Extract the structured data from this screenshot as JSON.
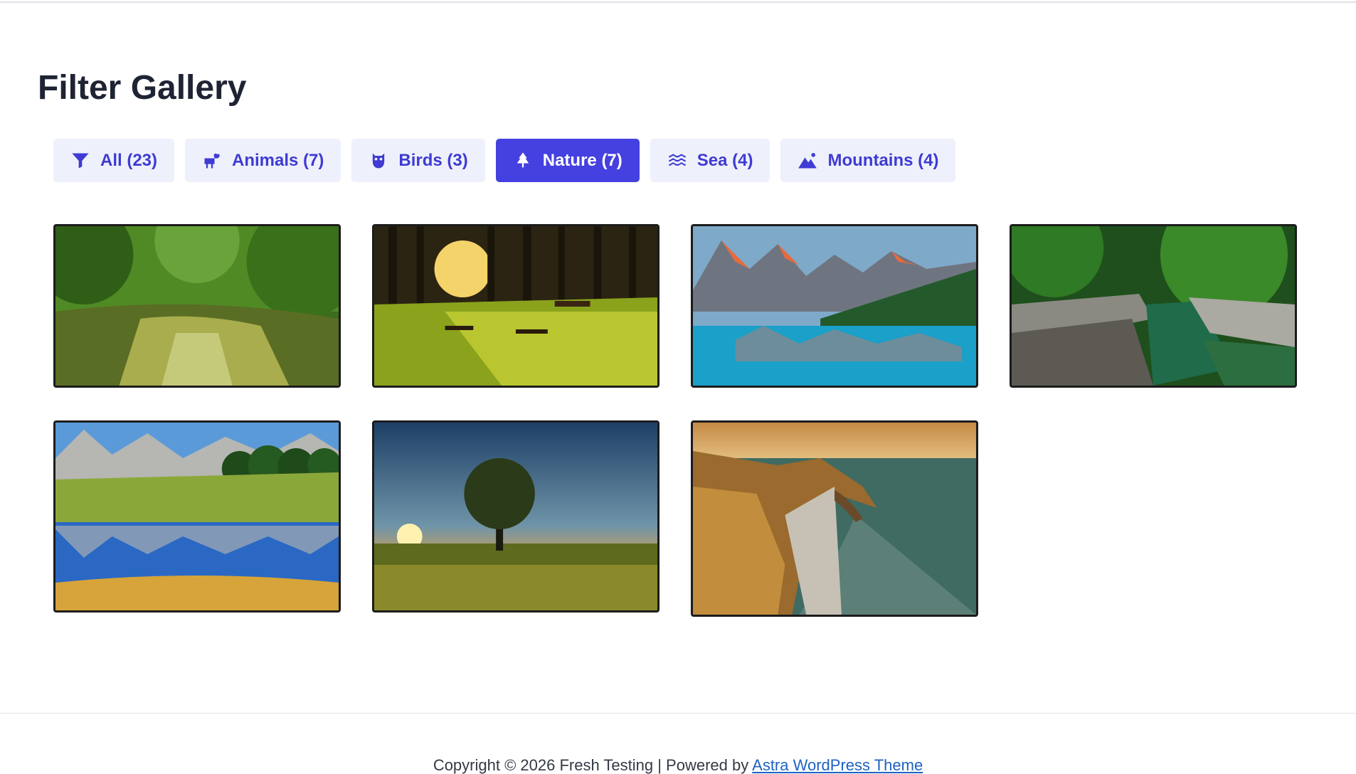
{
  "page": {
    "title": "Filter Gallery"
  },
  "filters": [
    {
      "label": "All (23)",
      "icon": "filter-icon",
      "active": false
    },
    {
      "label": "Animals (7)",
      "icon": "dog-icon",
      "active": false
    },
    {
      "label": "Birds (3)",
      "icon": "owl-icon",
      "active": false
    },
    {
      "label": "Nature (7)",
      "icon": "tree-icon",
      "active": true
    },
    {
      "label": "Sea (4)",
      "icon": "water-icon",
      "active": false
    },
    {
      "label": "Mountains (4)",
      "icon": "mountain-icon",
      "active": false
    }
  ],
  "gallery": {
    "items": [
      {
        "icon": "forest-river-image"
      },
      {
        "icon": "sunlit-forest-image"
      },
      {
        "icon": "mountain-lake-image"
      },
      {
        "icon": "forest-creek-image"
      },
      {
        "icon": "alpine-lake-image"
      },
      {
        "icon": "lone-tree-sunset-image"
      },
      {
        "icon": "coastal-arch-image"
      }
    ]
  },
  "footer": {
    "text": "Copyright © 2026 Fresh Testing | Powered by ",
    "link_text": "Astra WordPress Theme"
  },
  "colors": {
    "accent": "#4540e0",
    "button_bg": "#eef1fb",
    "link": "#1d63c2"
  }
}
